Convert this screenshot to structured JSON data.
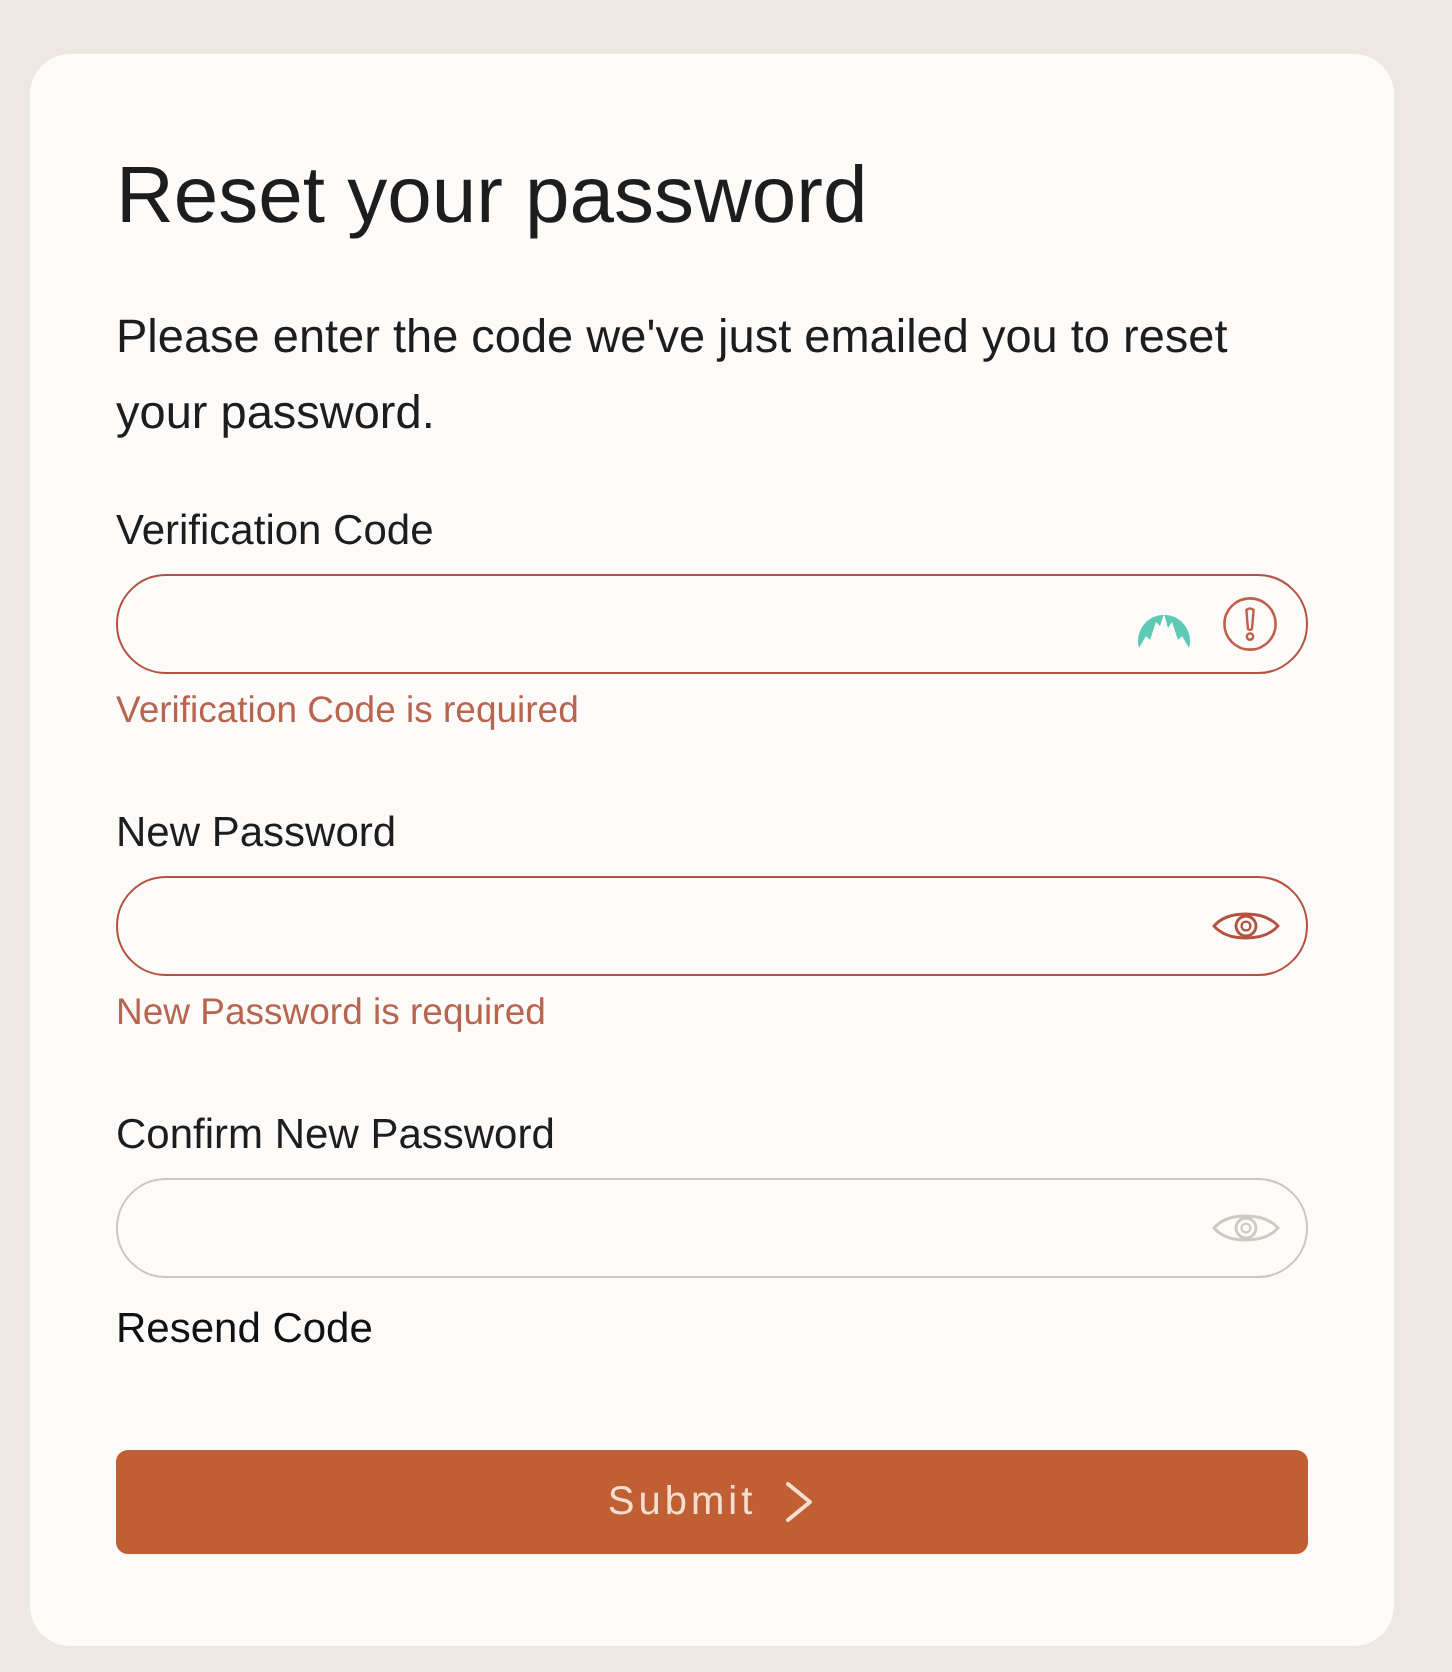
{
  "title": "Reset your password",
  "intro": "Please enter the code we've just emailed you to reset your password.",
  "fields": [
    {
      "kind": "code",
      "label": "Verification Code",
      "invalid": true,
      "error": "Verification Code is required"
    },
    {
      "kind": "password",
      "label": "New Password",
      "invalid": true,
      "error": "New Password is required"
    },
    {
      "kind": "password",
      "label": "Confirm New Password",
      "invalid": false
    }
  ],
  "resend_link": "Resend Code",
  "submit_button": {
    "label": "Submit"
  }
}
